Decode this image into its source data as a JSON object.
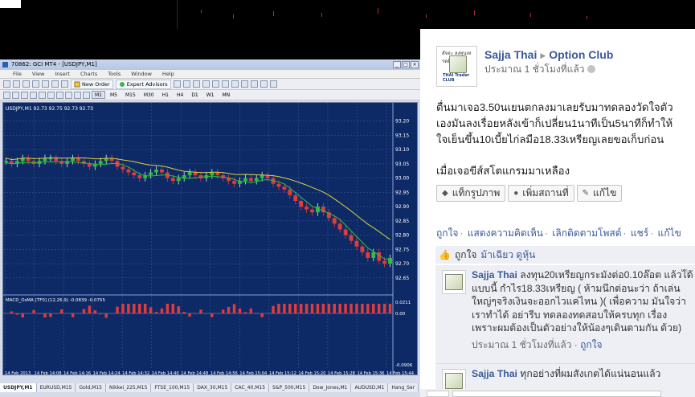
{
  "mt4": {
    "title": "70862: GCI MT4 - [USDJPY,M1]",
    "menu": [
      "File",
      "View",
      "Insert",
      "Charts",
      "Tools",
      "Window",
      "Help"
    ],
    "toolbar": {
      "new_order": "New Order",
      "expert_advisors": "Expert Advisors"
    },
    "timeframes": [
      "M1",
      "M5",
      "M15",
      "M30",
      "H1",
      "H4",
      "D1",
      "W1",
      "MN"
    ],
    "selected_timeframe": "M1",
    "chart_info": "USDJPY,M1  92.73 92.75 92.73 92.73",
    "macd_label": "MACD_OsMA [TF0] (12,26,9) -0.0839 -0.0755",
    "tabs": [
      "USDJPY,M1",
      "EURUSD,M15",
      "Gold,M15",
      "Nikkei_225,M15",
      "FTSE_100,M15",
      "DAX_30,M15",
      "CAC_40,M15",
      "S&P_500,M15",
      "Dow_Jones,M1",
      "AUDUSD,M1",
      "Hang_Ser"
    ]
  },
  "chart_data": {
    "type": "candlestick",
    "symbol": "USDJPY",
    "timeframe": "M1",
    "price_axis": [
      "93.20",
      "93.15",
      "93.10",
      "93.05",
      "93.00",
      "92.95",
      "92.90",
      "92.85",
      "92.80",
      "92.75",
      "92.70",
      "92.65"
    ],
    "ylim": [
      92.61,
      93.23
    ],
    "time_axis": [
      "14 Feb 2013",
      "14 Feb 14:08",
      "14 Feb 14:16",
      "14 Feb 14:24",
      "14 Feb 14:32",
      "14 Feb 14:40",
      "14 Feb 14:48",
      "14 Feb 14:56",
      "14 Feb 15:04",
      "14 Feb 15:12",
      "14 Feb 15:20",
      "14 Feb 15:28",
      "14 Feb 15:36",
      "14 Feb 15:44"
    ],
    "macd_axis": [
      "0.0211",
      "0.00",
      "-0.0906"
    ],
    "close_series": [
      93.06,
      93.05,
      93.06,
      93.07,
      93.06,
      93.05,
      93.06,
      93.07,
      93.07,
      93.06,
      93.05,
      93.06,
      93.07,
      93.06,
      93.05,
      93.04,
      93.05,
      93.06,
      93.07,
      93.06,
      93.04,
      93.03,
      93.02,
      93.01,
      93.0,
      93.01,
      93.02,
      93.03,
      93.02,
      93.0,
      92.99,
      93.0,
      93.01,
      93.02,
      93.01,
      93.0,
      93.01,
      93.02,
      93.01,
      93.0,
      92.99,
      92.98,
      92.99,
      93.0,
      92.99,
      93.0,
      93.01,
      93.0,
      92.98,
      92.97,
      92.96,
      92.94,
      92.92,
      92.9,
      92.89,
      92.88,
      92.9,
      92.88,
      92.86,
      92.84,
      92.82,
      92.8,
      92.78,
      92.76,
      92.74,
      92.72,
      92.74,
      92.71,
      92.7,
      92.72
    ]
  },
  "facebook": {
    "author": "Sajja Thai",
    "page": "Option Club",
    "time": "ประมาณ 1 ชั่วโมงที่แล้ว",
    "logo_top": "สัจจะ ลงทุนเทรดดิ้ง",
    "logo_bottom": "THAI Trader CLUB",
    "body_lines": [
      "ตื่นมาเจอ3.50นเยนตกลงมาเลยรับมาทดลองวัดใจตัว",
      "เองมันลงเรื่อยหลังเข้าก็เปลี่ยน1นาทีเป็น5นาทีก็ทำให้",
      "ใจเย็นขึ้น10เบี้ยไก่ลมือ18.33เหรียญเลยขอเก็บก่อน"
    ],
    "body_last": "เมื่อเจอขีส์สโตแกรมมาเหลือง",
    "actions": [
      "แท็กรูปภาพ",
      "เพิ่มสถานที่",
      "แก้ไข"
    ],
    "links": [
      "ถูกใจ",
      "แสดงความคิดเห็น",
      "เลิกติดตามโพสต์",
      "แชร์",
      "แก้ไข"
    ],
    "likes_prefix": "ถูกใจ",
    "likes_name": "ม้าเฉียว ดูหุ้น",
    "comments": [
      {
        "author": "Sajja Thai",
        "text": "ลงทุน20เหรียญกระมังต่อ0.10ล๊อต แล้วได้แบบนี้ กำไร18.33เหรียญ ( ห้ามนึกต่อนะว่า ถ้าเล่นใหญ่ๆจริงเงินจะออกไวแค่ไหน )( เพื่อความ มันใจว่าเราทำได้ อย่ารีบ ทดลองทดสอบให้ครบทุก เรื่อง เพราะผมต้องเป็นตัวอย่างให้น้องๆเดินตามกัน ด้วย)",
        "time": "ประมาณ 1 ชั่วโมงที่แล้ว",
        "like": "ถูกใจ"
      },
      {
        "author": "Sajja Thai",
        "text": "ทุกอย่างที่ผมสังเกตได้แน่นอนแล้ว"
      }
    ]
  }
}
